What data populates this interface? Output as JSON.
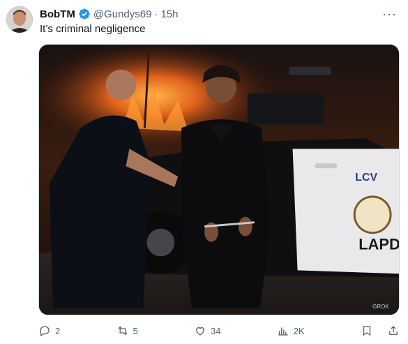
{
  "author": {
    "name": "BobTM",
    "handle": "@Gundys69",
    "separator": "·",
    "time": "15h",
    "verified": true
  },
  "tweet": {
    "text": "It’s criminal negligence"
  },
  "media": {
    "watermark": "GROK",
    "vehicle_text": "LAPD",
    "vehicle_badge": "LCV"
  },
  "actions": {
    "replies": "2",
    "reposts": "5",
    "likes": "34",
    "views": "2K"
  },
  "colors": {
    "text": "#0f1419",
    "muted": "#536471",
    "verified_blue": "#1d9bf0",
    "border": "#cfd9de"
  },
  "icons": {
    "verified": "verified-badge-icon",
    "more": "more-icon",
    "reply": "reply-icon",
    "repost": "repost-icon",
    "like": "heart-icon",
    "views": "views-icon",
    "bookmark": "bookmark-icon",
    "share": "share-icon"
  }
}
